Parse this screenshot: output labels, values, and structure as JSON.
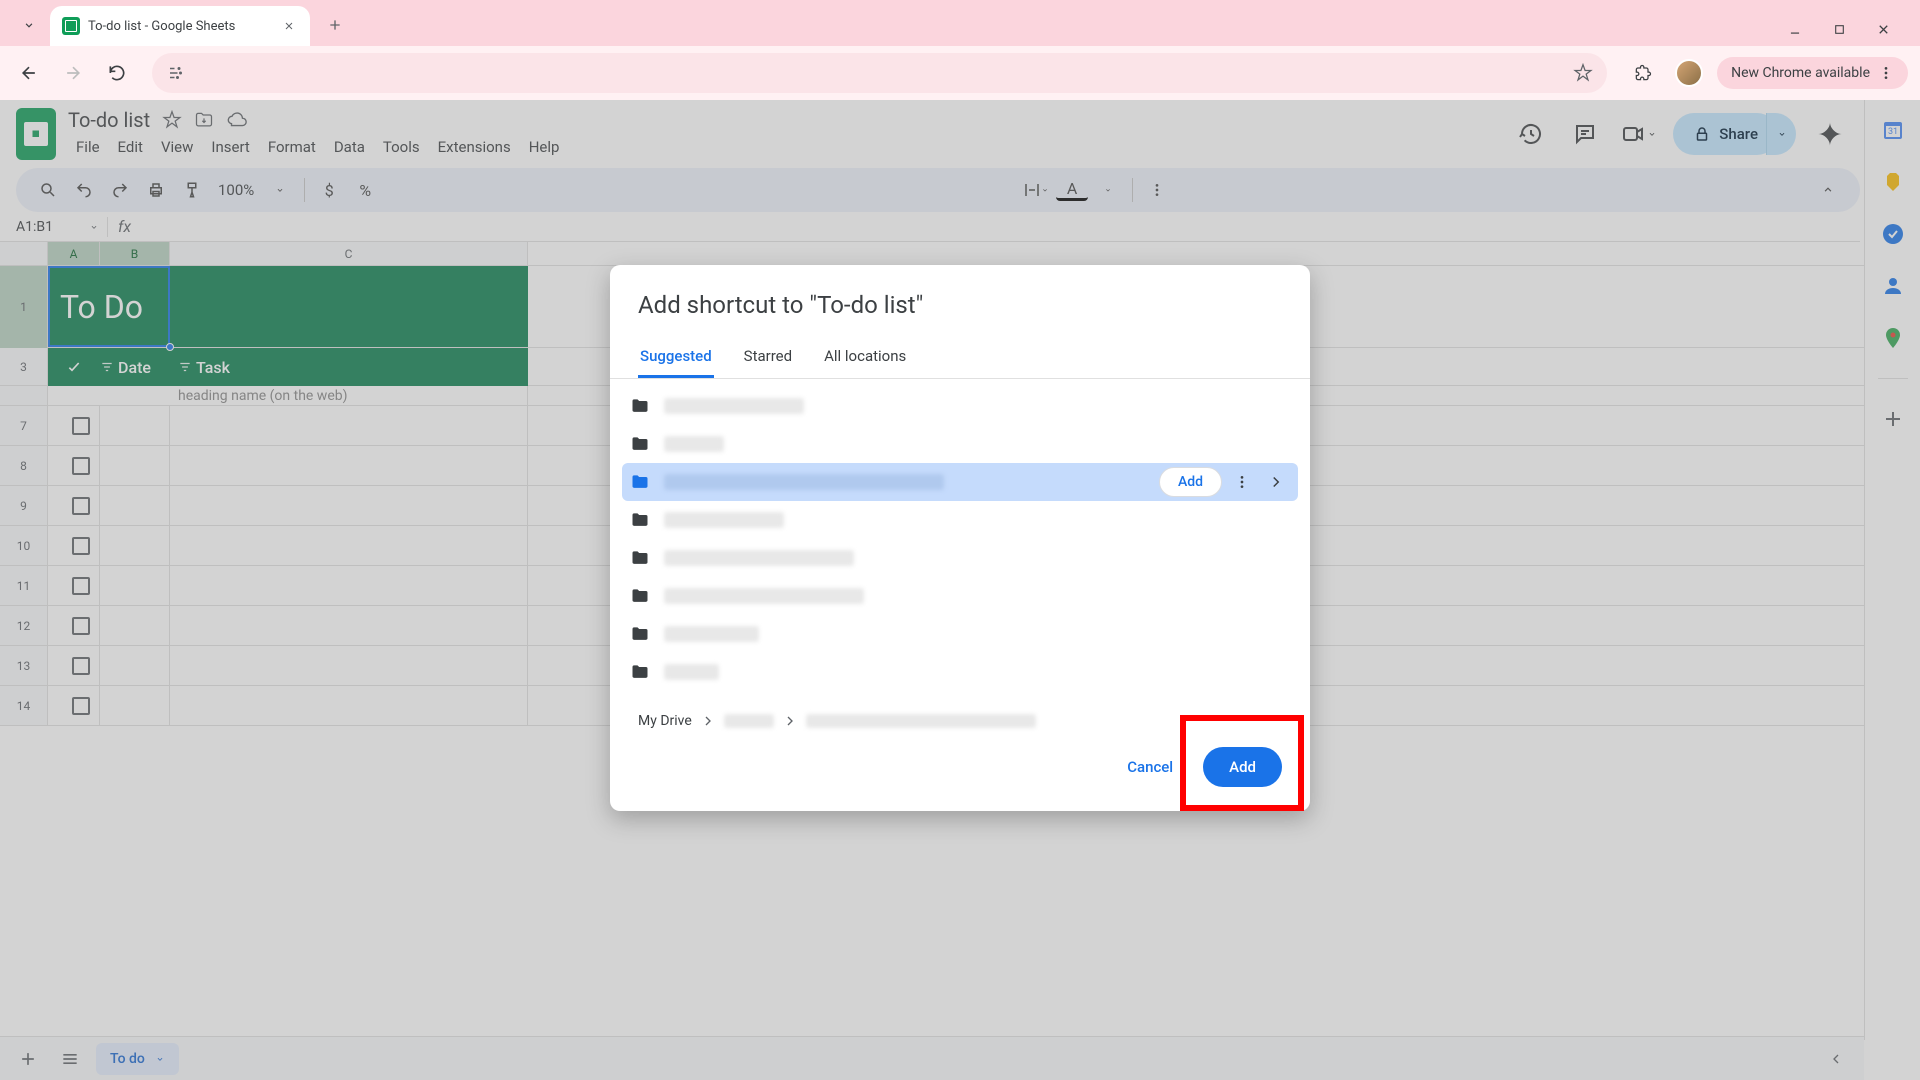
{
  "browser": {
    "tab_title": "To-do list - Google Sheets",
    "update_label": "New Chrome available"
  },
  "sheets": {
    "doc_title": "To-do list",
    "menus": [
      "File",
      "Edit",
      "View",
      "Insert",
      "Format",
      "Data",
      "Tools",
      "Extensions",
      "Help"
    ],
    "share_label": "Share",
    "zoom": "100%",
    "currency": "$",
    "percent": "%",
    "name_box": "A1:B1",
    "sheet_tab": "To do",
    "grid": {
      "columns": [
        "A",
        "B",
        "C"
      ],
      "rows_visible": [
        "1",
        "3",
        "7",
        "8",
        "9",
        "10",
        "11",
        "12",
        "13",
        "14"
      ],
      "todo_header": "To Do",
      "col_date": "Date",
      "col_task": "Task",
      "heading_hint": "heading name (on the web)"
    }
  },
  "modal": {
    "title": "Add shortcut to \"To-do list\"",
    "tabs": {
      "suggested": "Suggested",
      "starred": "Starred",
      "all": "All locations"
    },
    "row_add_label": "Add",
    "breadcrumb_root": "My Drive",
    "cancel": "Cancel",
    "add": "Add",
    "folder_redact_widths": [
      140,
      60,
      280,
      120,
      190,
      200,
      95,
      55
    ],
    "selected_index": 2
  },
  "side_panel": {
    "icons": [
      "calendar",
      "keep",
      "tasks",
      "contacts",
      "maps",
      "add"
    ]
  }
}
